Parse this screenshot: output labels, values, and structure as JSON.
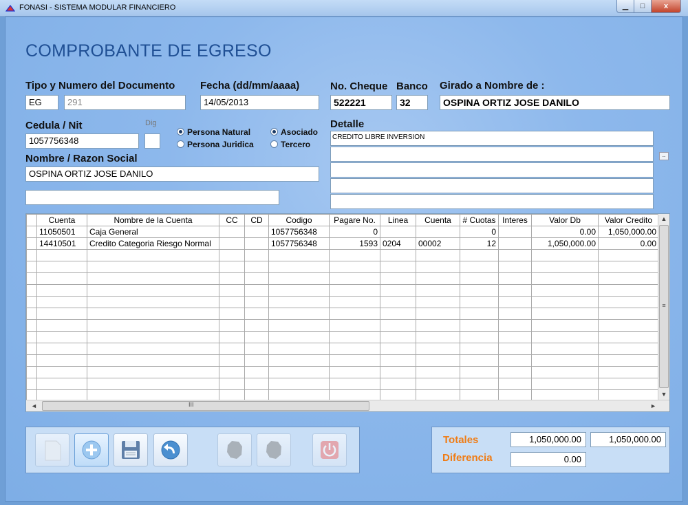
{
  "window": {
    "title": "FONASI - SISTEMA MODULAR FINANCIERO",
    "min_label": "▁",
    "max_label": "□",
    "close_label": "x"
  },
  "form": {
    "heading": "COMPROBANTE DE EGRESO",
    "tipo_label": "Tipo y Numero del Documento",
    "tipo_value": "EG",
    "numero_value": "291",
    "fecha_label": "Fecha (dd/mm/aaaa)",
    "fecha_value": "14/05/2013",
    "cheque_label": "No. Cheque",
    "cheque_value": "522221",
    "banco_label": "Banco",
    "banco_value": "32",
    "girado_label": "Girado a Nombre de :",
    "girado_value": "OSPINA ORTIZ JOSE DANILO",
    "cedula_label": "Cedula / Nit",
    "cedula_value": "1057756348",
    "dig_label": "Dig",
    "dig_value": "",
    "persona_natural": "Persona Natural",
    "persona_juridica": "Persona Juridica",
    "asociado": "Asociado",
    "tercero": "Tercero",
    "nombre_label": "Nombre  / Razon Social",
    "nombre_value": "OSPINA ORTIZ JOSE DANILO",
    "nombre_extra_value": "",
    "detalle_label": "Detalle",
    "detalle_lines": [
      "CREDITO LIBRE INVERSION",
      "",
      "",
      "",
      ""
    ],
    "detalle_button": ".."
  },
  "grid": {
    "columns": [
      "Cuenta",
      "Nombre de la Cuenta",
      "CC",
      "CD",
      "Codigo",
      "Pagare No.",
      "Linea",
      "Cuenta",
      "# Cuotas",
      "Interes",
      "Valor Db",
      "Valor Credito"
    ],
    "rows": [
      [
        "11050501",
        "Caja General",
        "",
        "",
        "1057756348",
        "0",
        "",
        "",
        "0",
        "",
        "0.00",
        "1,050,000.00"
      ],
      [
        "14410501",
        "Credito Categoria Riesgo Normal",
        "",
        "",
        "1057756348",
        "1593",
        "0204",
        "00002",
        "12",
        "",
        "1,050,000.00",
        "0.00"
      ]
    ],
    "empty_rows": 14,
    "scroll_up": "▲",
    "scroll_down": "▼",
    "scroll_left": "◄",
    "scroll_right": "►",
    "vgrip": "≡",
    "hgrip": "III"
  },
  "toolbar": {
    "buttons": [
      "new-document",
      "add",
      "save",
      "undo",
      "action-disabled-1",
      "action-disabled-2",
      "exit"
    ]
  },
  "totals": {
    "totales_label": "Totales",
    "total_db": "1,050,000.00",
    "total_cr": "1,050,000.00",
    "diferencia_label": "Diferencia",
    "diferencia_value": "0.00"
  },
  "colors": {
    "accent_orange": "#f07c14",
    "heading_blue": "#1f4f94",
    "background_blue": "#8db8ec"
  }
}
